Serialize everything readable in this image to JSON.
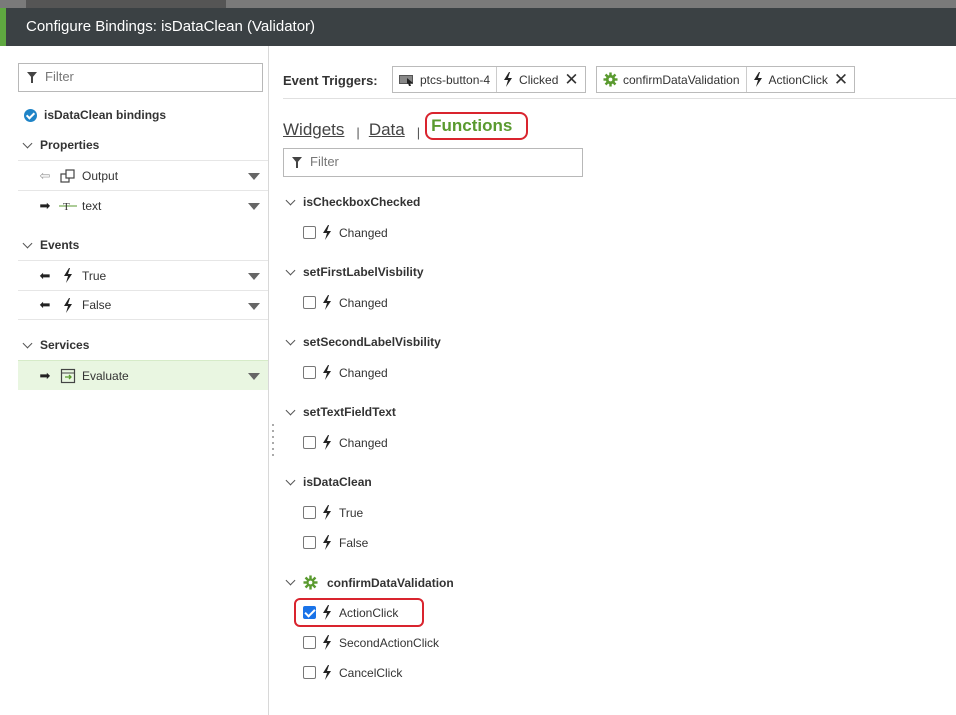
{
  "window": {
    "title": "Configure Bindings: isDataClean (Validator)"
  },
  "left": {
    "filter_placeholder": "Filter",
    "bindings_title": "isDataClean bindings",
    "sections": {
      "properties": "Properties",
      "events": "Events",
      "services": "Services"
    },
    "properties": [
      {
        "label": "Output",
        "direction": "in",
        "icon": "output-icon"
      },
      {
        "label": "text",
        "direction": "out",
        "icon": "text-icon"
      }
    ],
    "events": [
      {
        "label": "True",
        "icon": "lightning-icon"
      },
      {
        "label": "False",
        "icon": "lightning-icon"
      }
    ],
    "services": [
      {
        "label": "Evaluate",
        "icon": "service-icon",
        "selected": true
      }
    ]
  },
  "right": {
    "event_triggers_label": "Event Triggers:",
    "triggers": [
      {
        "source": "ptcs-button-4",
        "event": "Clicked"
      },
      {
        "source": "confirmDataValidation",
        "event": "ActionClick"
      }
    ],
    "tabs": [
      {
        "label": "Widgets",
        "active": false
      },
      {
        "label": "Data",
        "active": false
      },
      {
        "label": "Functions",
        "active": true
      }
    ],
    "filter_placeholder": "Filter",
    "groups": [
      {
        "name": "isCheckboxChecked",
        "items": [
          {
            "label": "Changed",
            "checked": false
          }
        ]
      },
      {
        "name": "setFirstLabelVisbility",
        "items": [
          {
            "label": "Changed",
            "checked": false
          }
        ]
      },
      {
        "name": "setSecondLabelVisbility",
        "items": [
          {
            "label": "Changed",
            "checked": false
          }
        ]
      },
      {
        "name": "setTextFieldText",
        "items": [
          {
            "label": "Changed",
            "checked": false
          }
        ]
      },
      {
        "name": "isDataClean",
        "items": [
          {
            "label": "True",
            "checked": false
          },
          {
            "label": "False",
            "checked": false
          }
        ]
      },
      {
        "name": "confirmDataValidation",
        "icon": "gear-icon",
        "items": [
          {
            "label": "ActionClick",
            "checked": true
          },
          {
            "label": "SecondActionClick",
            "checked": false
          },
          {
            "label": "CancelClick",
            "checked": false
          }
        ]
      }
    ]
  },
  "colors": {
    "accent_green": "#5a9a2f",
    "highlight_red": "#d9242e",
    "title_bar": "#3b4144",
    "checkbox_blue": "#1a73e8"
  }
}
